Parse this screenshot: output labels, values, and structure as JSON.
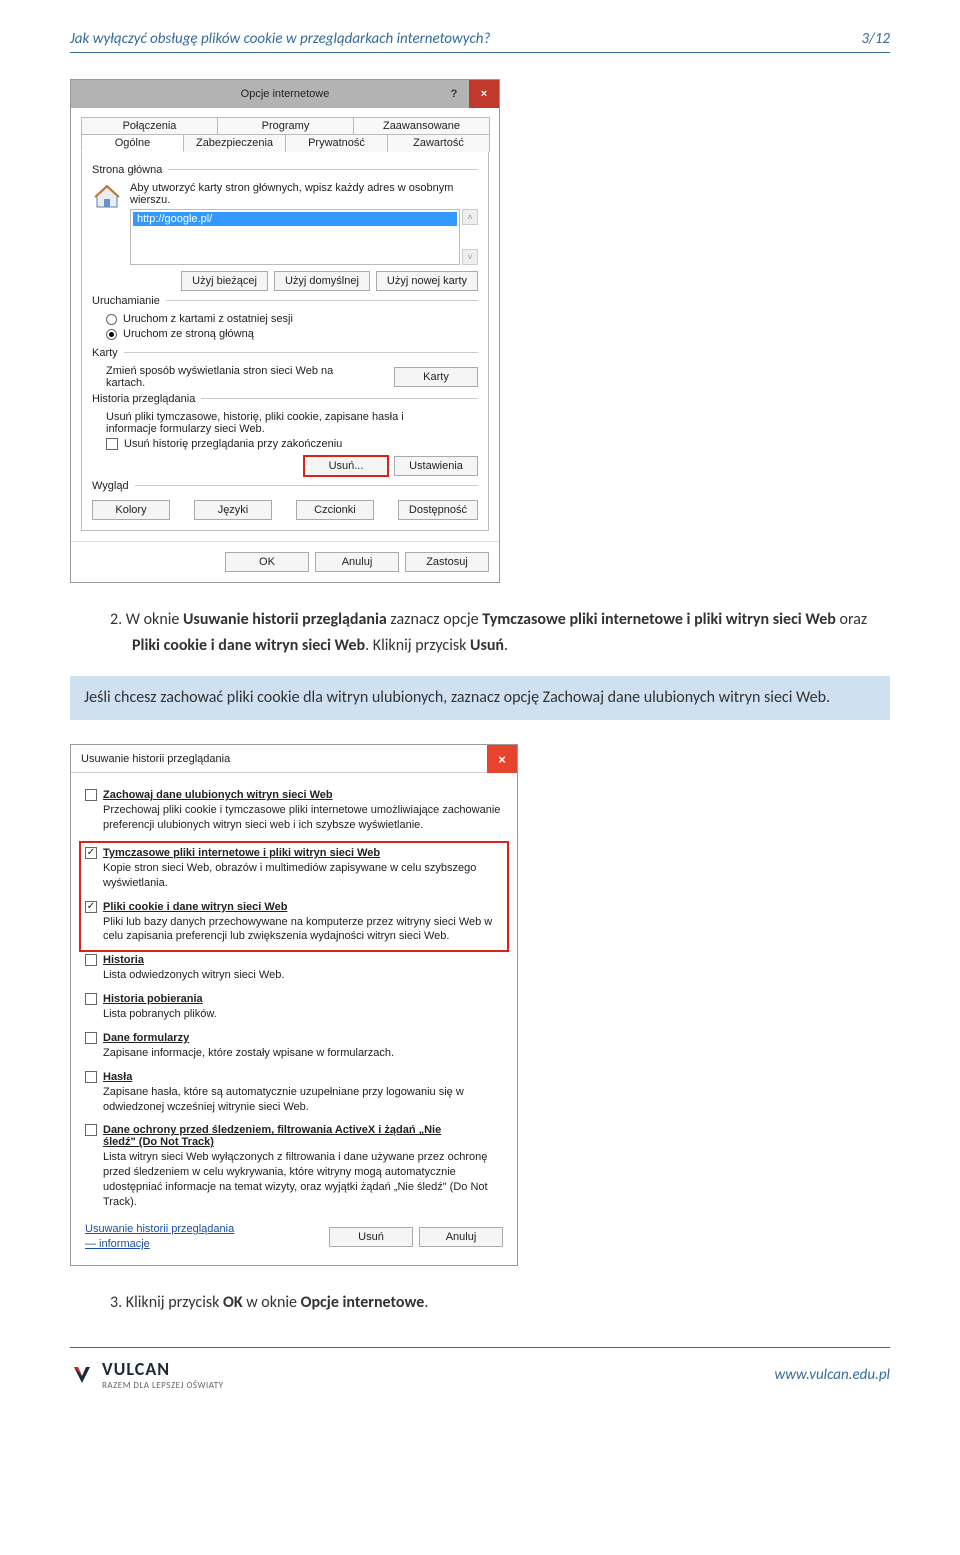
{
  "header": {
    "title": "Jak wyłączyć obsługę plików cookie w przeglądarkach internetowych?",
    "page": "3/12"
  },
  "io": {
    "title": "Opcje internetowe",
    "help": "?",
    "close": "×",
    "tabs_row1": [
      "Połączenia",
      "Programy",
      "Zaawansowane"
    ],
    "tabs_row2": [
      "Ogólne",
      "Zabezpieczenia",
      "Prywatność",
      "Zawartość"
    ],
    "home": {
      "label": "Strona główna",
      "hint": "Aby utworzyć karty stron głównych, wpisz każdy adres w osobnym wierszu.",
      "addr": "http://google.pl/",
      "btn_current": "Użyj bieżącej",
      "btn_default": "Użyj domyślnej",
      "btn_new": "Użyj nowej karty"
    },
    "startup": {
      "label": "Uruchamianie",
      "opt1": "Uruchom z kartami z ostatniej sesji",
      "opt2": "Uruchom ze stroną główną"
    },
    "cards": {
      "label": "Karty",
      "text": "Zmień sposób wyświetlania stron sieci Web na kartach.",
      "btn": "Karty"
    },
    "history": {
      "label": "Historia przeglądania",
      "text": "Usuń pliki tymczasowe, historię, pliki cookie, zapisane hasła i informacje formularzy sieci Web.",
      "chk": "Usuń historię przeglądania przy zakończeniu",
      "btn_del": "Usuń...",
      "btn_set": "Ustawienia"
    },
    "look": {
      "label": "Wygląd",
      "b1": "Kolory",
      "b2": "Języki",
      "b3": "Czcionki",
      "b4": "Dostępność"
    },
    "footer": {
      "ok": "OK",
      "cancel": "Anuluj",
      "apply": "Zastosuj"
    }
  },
  "instr1_prefix": "2.  W oknie ",
  "instr1_b1": "Usuwanie historii przeglądania",
  "instr1_mid1": " zaznacz opcje ",
  "instr1_b2": "Tymczasowe pliki internetowe i pliki witryn sieci Web",
  "instr1_mid2": " oraz ",
  "instr1_b3": "Pliki cookie i dane witryn sieci Web",
  "instr1_mid3": ". Kliknij przycisk ",
  "instr1_b4": "Usuń",
  "instr1_end": ".",
  "hint_prefix": "Jeśli chcesz zachować pliki cookie dla witryn ulubionych, zaznacz opcję ",
  "hint_bold": "Zachowaj dane ulubionych witryn sieci Web",
  "hint_end": ".",
  "dh": {
    "title": "Usuwanie historii przeglądania",
    "close": "×",
    "s1": {
      "t": "Zachowaj dane ulubionych witryn sieci Web",
      "d": "Przechowaj pliki cookie i tymczasowe pliki internetowe umożliwiające zachowanie preferencji ulubionych witryn sieci web i ich szybsze wyświetlanie."
    },
    "s2": {
      "t": "Tymczasowe pliki internetowe i pliki witryn sieci Web",
      "d": "Kopie stron sieci Web, obrazów i multimediów zapisywane w celu szybszego wyświetlania."
    },
    "s3": {
      "t": "Pliki cookie i dane witryn sieci Web",
      "d": "Pliki lub bazy danych przechowywane na komputerze przez witryny sieci Web w celu zapisania preferencji lub zwiększenia wydajności witryn sieci Web."
    },
    "s4": {
      "t": "Historia",
      "d": "Lista odwiedzonych witryn sieci Web."
    },
    "s5": {
      "t": "Historia pobierania",
      "d": "Lista pobranych plików."
    },
    "s6": {
      "t": "Dane formularzy",
      "d": "Zapisane informacje, które zostały wpisane w formularzach."
    },
    "s7": {
      "t": "Hasła",
      "d": "Zapisane hasła, które są automatycznie uzupełniane przy logowaniu się w odwiedzonej wcześniej witrynie sieci Web."
    },
    "s8": {
      "t": "Dane ochrony przed śledzeniem, filtrowania ActiveX i żądań „Nie śledź\" (Do Not Track)",
      "d": "Lista witryn sieci Web wyłączonych z filtrowania i dane używane przez ochronę przed śledzeniem w celu wykrywania, które witryny mogą automatycznie udostępniać informacje na temat wizyty, oraz wyjątki żądań „Nie śledź\" (Do Not Track)."
    },
    "link1": "Usuwanie historii przeglądania",
    "link2": "— informacje",
    "btn_del": "Usuń",
    "btn_cancel": "Anuluj"
  },
  "instr2_prefix": "3.   Kliknij przycisk ",
  "instr2_b1": "OK",
  "instr2_mid": " w oknie ",
  "instr2_b2": "Opcje internetowe",
  "instr2_end": ".",
  "footerw": {
    "brand": "VULCAN",
    "tag": "RAZEM DLA LEPSZEJ OŚWIATY",
    "url": "www.vulcan.edu.pl"
  }
}
